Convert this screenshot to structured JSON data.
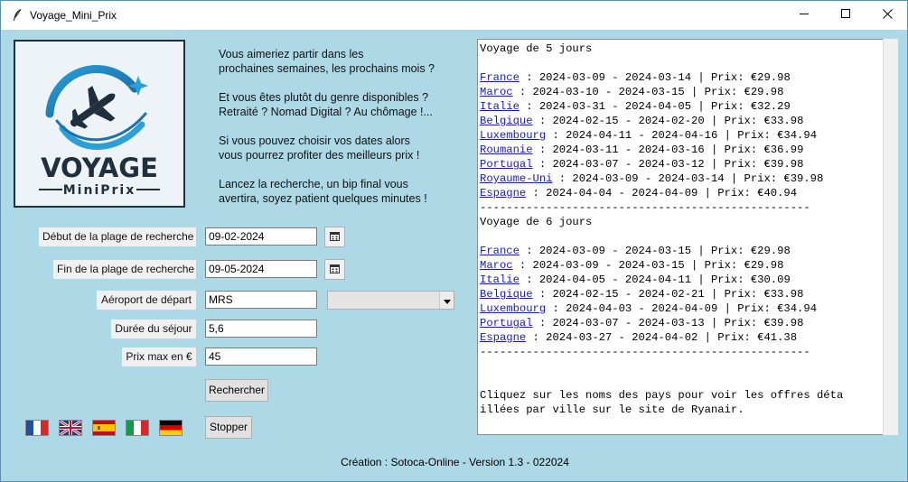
{
  "window": {
    "title": "Voyage_Mini_Prix"
  },
  "logo": {
    "word1": "VOYAGE",
    "word2": "MiniPrix"
  },
  "intro": [
    [
      "Vous aimeriez partir dans les",
      "prochaines semaines, les prochains mois ?"
    ],
    [
      "Et vous êtes plutôt du genre disponibles ?",
      "Retraité ? Nomad Digital ? Au chômage !..."
    ],
    [
      "Si vous pouvez choisir vos dates alors",
      "vous pourrez profiter des meilleurs prix !"
    ],
    [
      "Lancez la recherche, un bip final vous",
      "avertira, soyez patient quelques minutes !"
    ]
  ],
  "form": {
    "start_label": "Début de la plage de recherche",
    "start_value": "09-02-2024",
    "end_label": "Fin de la plage de recherche",
    "end_value": "09-05-2024",
    "airport_label": "Aéroport de départ",
    "airport_value": "MRS",
    "airport_select_value": "",
    "duration_label": "Durée du séjour",
    "duration_value": "5,6",
    "price_label": "Prix max en €",
    "price_value": "45"
  },
  "buttons": {
    "search": "Rechercher",
    "stop": "Stopper"
  },
  "flags": [
    "france",
    "united-kingdom",
    "spain",
    "italy",
    "germany"
  ],
  "footer": "Création : Sotoca-Online - Version 1.3 - 022024",
  "results": [
    {
      "text": "Voyage de 5 jours"
    },
    {
      "text": ""
    },
    {
      "country": "France",
      "rest": " : 2024-03-09 - 2024-03-14 | Prix: €29.98"
    },
    {
      "country": "Maroc",
      "rest": " : 2024-03-10 - 2024-03-15 | Prix: €29.98"
    },
    {
      "country": "Italie",
      "rest": " : 2024-03-31 - 2024-04-05 | Prix: €32.29"
    },
    {
      "country": "Belgique",
      "rest": " : 2024-02-15 - 2024-02-20 | Prix: €33.98"
    },
    {
      "country": "Luxembourg",
      "rest": " : 2024-04-11 - 2024-04-16 | Prix: €34.94"
    },
    {
      "country": "Roumanie",
      "rest": " : 2024-03-11 - 2024-03-16 | Prix: €36.99"
    },
    {
      "country": "Portugal",
      "rest": " : 2024-03-07 - 2024-03-12 | Prix: €39.98"
    },
    {
      "country": "Royaume-Uni",
      "rest": " : 2024-03-09 - 2024-03-14 | Prix: €39.98"
    },
    {
      "country": "Espagne",
      "rest": " : 2024-04-04 - 2024-04-09 | Prix: €40.94"
    },
    {
      "text": "--------------------------------------------------"
    },
    {
      "text": "Voyage de 6 jours"
    },
    {
      "text": ""
    },
    {
      "country": "France",
      "rest": " : 2024-03-09 - 2024-03-15 | Prix: €29.98"
    },
    {
      "country": "Maroc",
      "rest": " : 2024-03-09 - 2024-03-15 | Prix: €29.98"
    },
    {
      "country": "Italie",
      "rest": " : 2024-04-05 - 2024-04-11 | Prix: €30.09"
    },
    {
      "country": "Belgique",
      "rest": " : 2024-02-15 - 2024-02-21 | Prix: €33.98"
    },
    {
      "country": "Luxembourg",
      "rest": " : 2024-04-03 - 2024-04-09 | Prix: €34.94"
    },
    {
      "country": "Portugal",
      "rest": " : 2024-03-07 - 2024-03-13 | Prix: €39.98"
    },
    {
      "country": "Espagne",
      "rest": " : 2024-03-27 - 2024-04-02 | Prix: €41.38"
    },
    {
      "text": "--------------------------------------------------"
    },
    {
      "text": ""
    },
    {
      "text": ""
    },
    {
      "text": "Cliquez sur les noms des pays pour voir les offres déta"
    },
    {
      "text": "illées par ville sur le site de Ryanair."
    }
  ]
}
